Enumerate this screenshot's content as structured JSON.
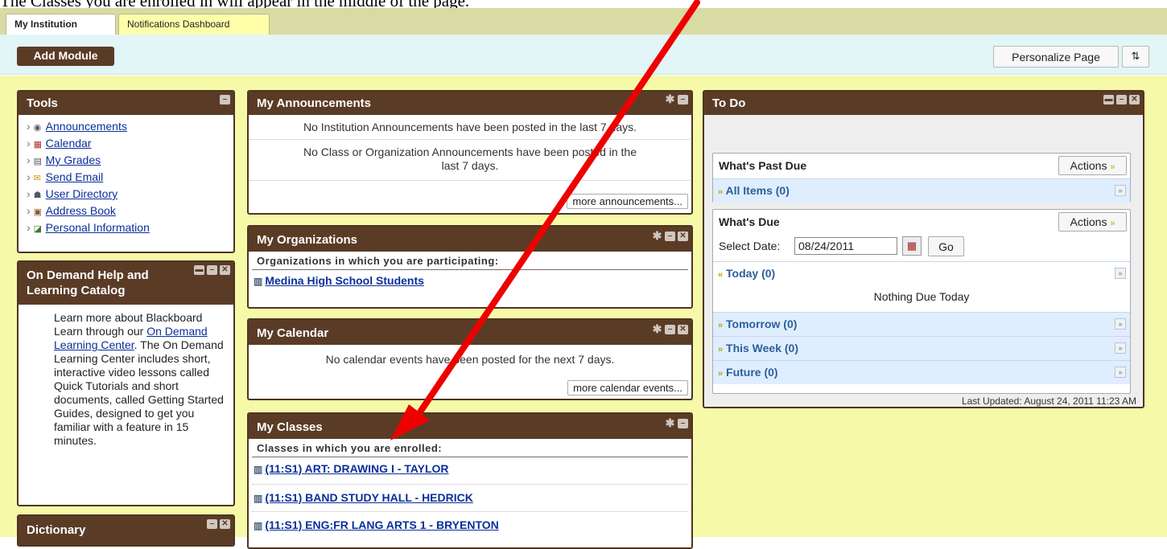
{
  "caption": "The Classes you are enrolled in will appear in the middle of the page.",
  "tabs": [
    {
      "label": "My Institution"
    },
    {
      "label": "Notifications Dashboard"
    }
  ],
  "toolbar": {
    "add_module": "Add Module",
    "personalize": "Personalize Page",
    "reorder_icon": "⇅"
  },
  "tools": {
    "title": "Tools",
    "items": [
      {
        "label": "Announcements",
        "icon": "megaphone-icon"
      },
      {
        "label": "Calendar",
        "icon": "calendar-icon"
      },
      {
        "label": "My Grades",
        "icon": "grades-icon"
      },
      {
        "label": "Send Email",
        "icon": "email-icon"
      },
      {
        "label": "User Directory",
        "icon": "directory-icon"
      },
      {
        "label": "Address Book",
        "icon": "address-book-icon"
      },
      {
        "label": "Personal Information",
        "icon": "personal-info-icon"
      }
    ]
  },
  "ondemand": {
    "title": "On Demand Help and Learning Catalog",
    "text_before": "Learn more about Blackboard Learn through our ",
    "link": "On Demand Learning Center",
    "text_after": ". The On Demand Learning Center includes short, interactive video lessons called Quick Tutorials and short documents, called Getting Started Guides, designed to get you familiar with a feature in 15 minutes."
  },
  "dictionary": {
    "title": "Dictionary"
  },
  "announcements": {
    "title": "My Announcements",
    "institution_msg": "No Institution Announcements have been posted in the last 7 days.",
    "class_msg": "No Class or Organization Announcements have been posted in the last 7 days.",
    "more": "more announcements..."
  },
  "organizations": {
    "title": "My Organizations",
    "subhead": "Organizations in which you are participating:",
    "items": [
      "Medina High School Students"
    ]
  },
  "calendar": {
    "title": "My Calendar",
    "msg": "No calendar events have been posted for the next 7 days.",
    "more": "more calendar events..."
  },
  "classes": {
    "title": "My Classes",
    "subhead": "Classes in which you are enrolled:",
    "items": [
      "(11:S1) ART: DRAWING I - TAYLOR",
      "(11:S1) BAND STUDY HALL - HEDRICK",
      "(11:S1) ENG:FR LANG ARTS 1 - BRYENTON"
    ]
  },
  "todo": {
    "title": "To Do",
    "past_due": {
      "title": "What's Past Due",
      "actions": "Actions",
      "all_items": "All Items (0)"
    },
    "due": {
      "title": "What's Due",
      "actions": "Actions",
      "select_date_label": "Select Date:",
      "date_value": "08/24/2011",
      "go": "Go",
      "today": "Today (0)",
      "nothing_due": "Nothing Due Today",
      "tomorrow": "Tomorrow (0)",
      "this_week": "This Week (0)",
      "future": "Future (0)"
    },
    "last_updated": "Last Updated: August 24, 2011 11:23 AM"
  },
  "colors": {
    "module_header": "#5a3c26",
    "page_bg": "#f6f9a8",
    "toolbar_bg": "#e2f5f7",
    "link": "#0a2f9a",
    "arrow": "#ee0000"
  }
}
